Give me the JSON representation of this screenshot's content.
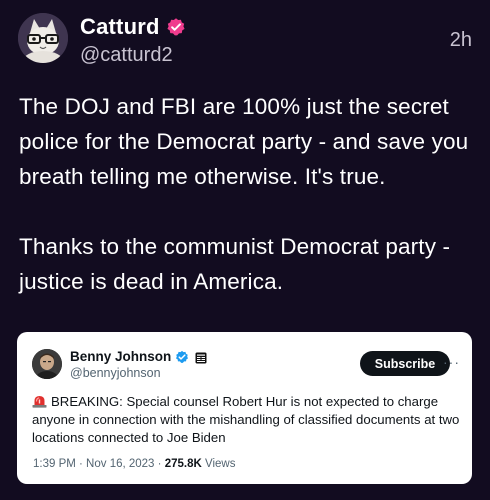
{
  "post": {
    "display_name": "Catturd",
    "handle": "@catturd2",
    "timestamp": "2h",
    "body_paragraph_1": "The DOJ and FBI are 100% just the secret police for the Democrat party - and save you breath telling me otherwise. It's true.",
    "body_paragraph_2": "Thanks to the communist Democrat party - justice is dead in America.",
    "verified_icon": "verified-badge-icon",
    "verified_color": "#f03c8e",
    "background_color": "#120c20"
  },
  "quote": {
    "display_name": "Benny Johnson",
    "handle": "@bennyjohnson",
    "subscribe_label": "Subscribe",
    "more_label": "···",
    "alert_icon": "siren-icon",
    "text": "BREAKING: Special counsel Robert Hur is not expected to charge anyone in connection with the mishandling of classified documents at two locations connected to Joe Biden",
    "date": "1:39 PM · Nov 16, 2023 · ",
    "views_count": "275.8K",
    "views_label": " Views",
    "verified_color": "#1d9bf0"
  }
}
